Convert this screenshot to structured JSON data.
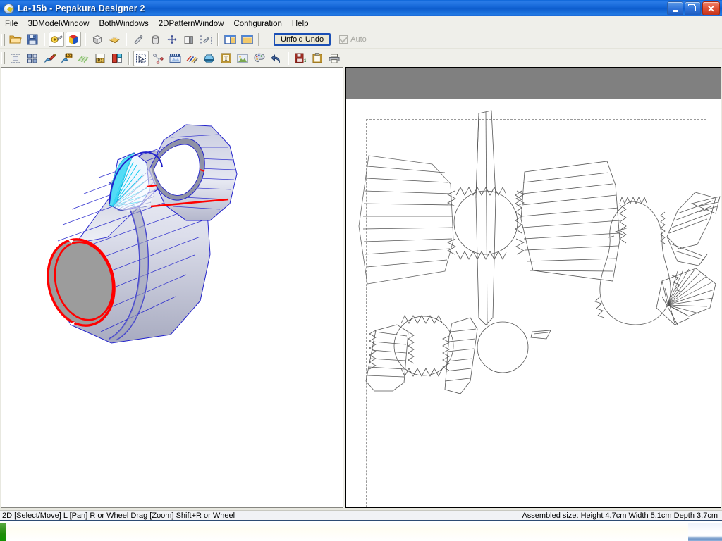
{
  "window": {
    "title": "La-15b - Pepakura Designer 2",
    "icon": "pepakura-app-icon",
    "controls": {
      "minimize": "Minimize",
      "restore": "Restore",
      "close": "Close"
    }
  },
  "menu": {
    "items": [
      {
        "label": "File",
        "name": "menu-file"
      },
      {
        "label": "3DModelWindow",
        "name": "menu-3dmodelwindow"
      },
      {
        "label": "BothWindows",
        "name": "menu-bothwindows"
      },
      {
        "label": "2DPatternWindow",
        "name": "menu-2dpatternwindow"
      },
      {
        "label": "Configuration",
        "name": "menu-configuration"
      },
      {
        "label": "Help",
        "name": "menu-help"
      }
    ]
  },
  "toolbar_row1": {
    "buttons": [
      {
        "name": "open-file-icon",
        "title": "Open"
      },
      {
        "name": "save-file-icon",
        "title": "Save"
      },
      {
        "name": "texture-paint-icon",
        "title": "Texture",
        "pressed": true
      },
      {
        "name": "model-color-icon",
        "title": "Model Color",
        "pressed": true
      },
      {
        "name": "flat-shading-icon",
        "title": "Flat Shading"
      },
      {
        "name": "texture-view-icon",
        "title": "Texture View"
      },
      {
        "name": "edge-select-icon",
        "title": "Edge Select"
      },
      {
        "name": "cylinder-icon",
        "title": "Cylinder"
      },
      {
        "name": "flip-axis-icon",
        "title": "Flip Axis"
      },
      {
        "name": "open-close-icon",
        "title": "Open Close"
      },
      {
        "name": "select-region-icon",
        "title": "Select Region"
      },
      {
        "name": "window-split-vertical-icon",
        "title": "Split Vertical"
      },
      {
        "name": "window-single-icon",
        "title": "Single Window"
      }
    ],
    "unfold_undo_label": "Unfold Undo",
    "auto_label": "Auto",
    "auto_checked": true
  },
  "toolbar_row2": {
    "buttons": [
      {
        "name": "select-area-icon",
        "title": "Select Area"
      },
      {
        "name": "arrange-parts-icon",
        "title": "Arrange Parts"
      },
      {
        "name": "edit-flap-icon",
        "title": "Edit Flap"
      },
      {
        "name": "number-tabs-icon",
        "title": "Number Tabs"
      },
      {
        "name": "line-style-icon",
        "title": "Line Style"
      },
      {
        "name": "page-layout-icon",
        "title": "Page Layout"
      },
      {
        "name": "fold-line-icon",
        "title": "Fold Line"
      },
      {
        "name": "pointer-select-icon",
        "title": "Pointer Select",
        "pressed": true
      },
      {
        "name": "join-disjoin-icon",
        "title": "Join / Disjoin"
      },
      {
        "name": "film-strip-icon",
        "title": "Animation"
      },
      {
        "name": "line-colors-icon",
        "title": "Line Colors"
      },
      {
        "name": "scale-icon",
        "title": "Scale"
      },
      {
        "name": "add-text-icon",
        "title": "Add Text"
      },
      {
        "name": "add-image-icon",
        "title": "Add Image"
      },
      {
        "name": "palette-icon",
        "title": "Palette"
      },
      {
        "name": "undo-icon",
        "title": "Undo"
      },
      {
        "name": "save-as-icon",
        "title": "Save As"
      },
      {
        "name": "clipboard-icon",
        "title": "Clipboard"
      },
      {
        "name": "print-icon",
        "title": "Print"
      }
    ]
  },
  "panes": {
    "model_3d": {
      "name": "3d-model-viewport",
      "model": "La-15b fuselage with canopy",
      "colors": {
        "edge": "#2222cc",
        "highlight": "#ff0000",
        "accent": "#00d0f0",
        "face_light": "#eceef8",
        "face_mid": "#c6c9dd",
        "face_dark": "#9ea1b6",
        "face_cap": "#9c9c9c"
      }
    },
    "pattern_2d": {
      "name": "2d-pattern-viewport",
      "page_background": "#ffffff",
      "header_band_color": "#808080",
      "margin_style": "dashed"
    }
  },
  "statusbar": {
    "hint": "2D [Select/Move] L [Pan] R or Wheel Drag [Zoom] Shift+R or Wheel",
    "assembled_size": "Assembled size: Height 4.7cm Width 5.1cm Depth 3.7cm"
  },
  "taskbar": {
    "start_color": "#1f8c0a",
    "tray_color": "#8fb0da"
  }
}
